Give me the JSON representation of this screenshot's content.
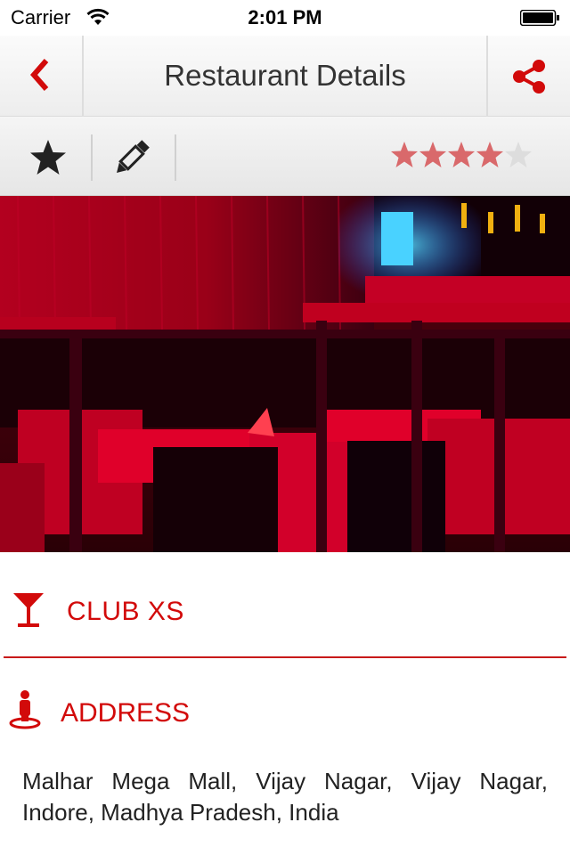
{
  "status_bar": {
    "carrier": "Carrier",
    "time": "2:01 PM"
  },
  "nav": {
    "title": "Restaurant Details",
    "back_icon": "chevron-left-icon",
    "share_icon": "share-icon"
  },
  "toolbar": {
    "favorite_icon": "star-icon",
    "edit_icon": "pencil-icon",
    "rating": 4,
    "rating_max": 5
  },
  "restaurant": {
    "name": "CLUB XS",
    "address_label": "ADDRESS",
    "address": "Malhar Mega Mall, Vijay Nagar, Vijay Nagar, Indore, Madhya Pradesh, India"
  },
  "colors": {
    "accent": "#d20a0a",
    "star_filled": "#d9696b",
    "star_empty": "#dddddd"
  }
}
